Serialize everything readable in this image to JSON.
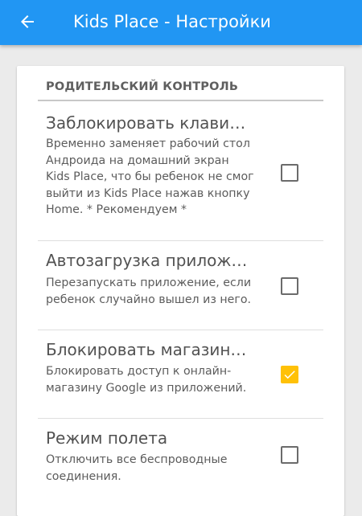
{
  "colors": {
    "app_bar": "#2196f3",
    "accent": "#ffc107",
    "background": "#ebebeb"
  },
  "header": {
    "back_icon": "arrow-left-icon",
    "title": "Kids Place - Настройки"
  },
  "section": {
    "title": "РОДИТЕЛЬСКИЙ КОНТРОЛЬ"
  },
  "preferences": [
    {
      "title": "Заблокировать клавиатуру",
      "summary": "Временно заменяет рабочий стол Андроида на домашний экран Kids Place, что бы ребенок не смог выйти из Kids Place нажав кнопку Home. * Рекомендуем *",
      "checked": false
    },
    {
      "title": "Автозагрузка приложения",
      "summary": "Перезапускать приложение, если ребенок случайно вышел из него.",
      "checked": false
    },
    {
      "title": "Блокировать магазин приложений",
      "summary": "Блокировать доступ к онлайн-магазину Google из приложений.",
      "checked": true
    },
    {
      "title": "Режим полета",
      "summary": "Отключить все беспроводные соединения.",
      "checked": false
    }
  ]
}
